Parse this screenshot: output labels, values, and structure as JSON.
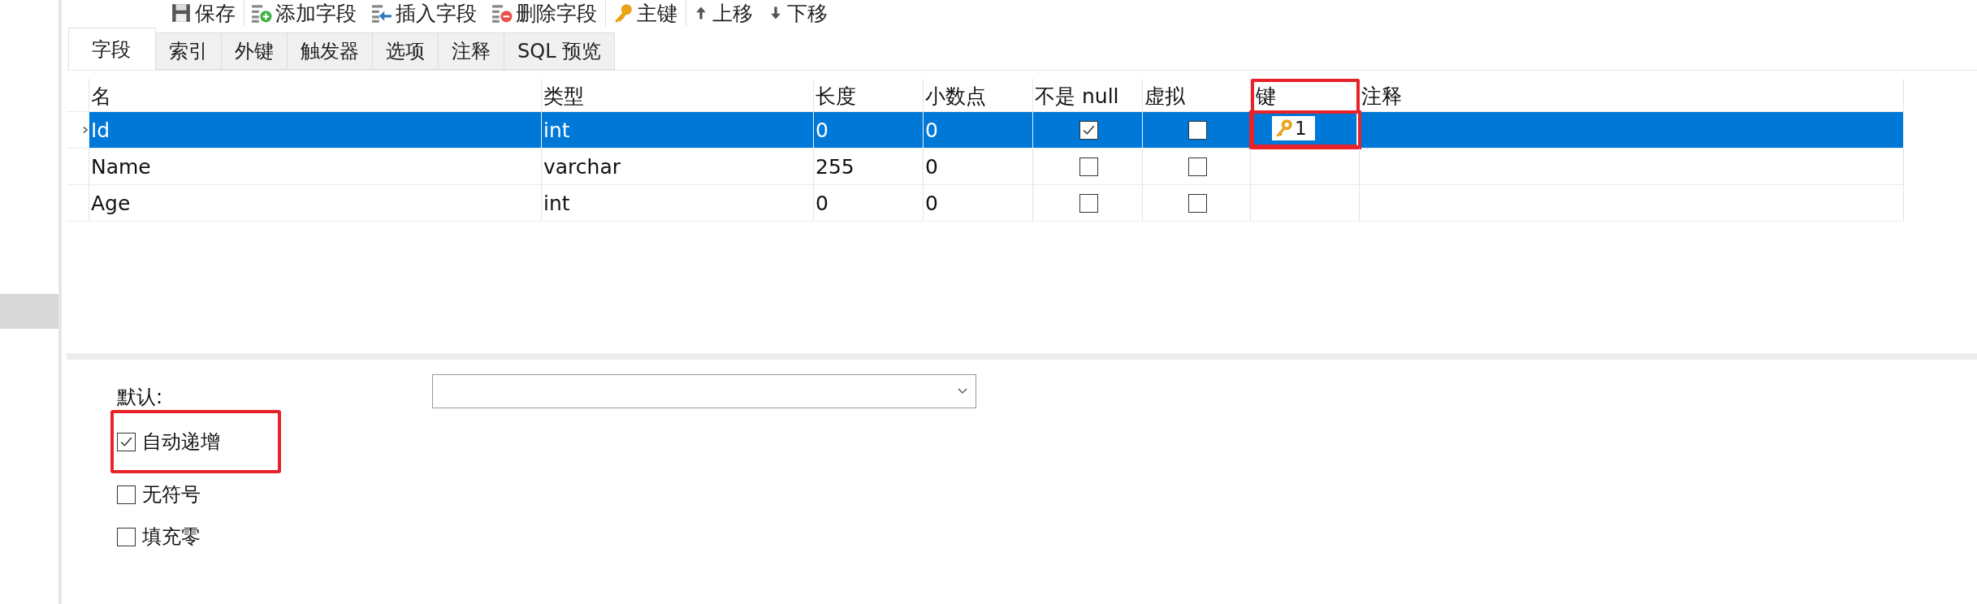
{
  "toolbar": [
    {
      "kind": "save",
      "label": "保存"
    },
    {
      "kind": "add",
      "label": "添加字段"
    },
    {
      "kind": "insert",
      "label": "插入字段"
    },
    {
      "kind": "delete",
      "label": "删除字段"
    },
    {
      "kind": "key",
      "label": "主键"
    },
    {
      "kind": "up",
      "label": "上移"
    },
    {
      "kind": "down",
      "label": "下移"
    }
  ],
  "tabs": [
    {
      "label": "字段",
      "selected": true
    },
    {
      "label": "索引",
      "selected": false
    },
    {
      "label": "外键",
      "selected": false
    },
    {
      "label": "触发器",
      "selected": false
    },
    {
      "label": "选项",
      "selected": false
    },
    {
      "label": "注释",
      "selected": false
    },
    {
      "label": "SQL 预览",
      "selected": false
    }
  ],
  "table": {
    "columns": [
      {
        "label": "名",
        "highlighted": false
      },
      {
        "label": "类型",
        "highlighted": false
      },
      {
        "label": "长度",
        "highlighted": false
      },
      {
        "label": "小数点",
        "highlighted": false
      },
      {
        "label": "不是 null",
        "highlighted": false
      },
      {
        "label": "虚拟",
        "highlighted": false
      },
      {
        "label": "键",
        "highlighted": true
      },
      {
        "label": "注释",
        "highlighted": false
      }
    ],
    "rows": [
      {
        "name": "Id",
        "type": "int",
        "length": "0",
        "decimals": "0",
        "not_null": true,
        "virtual": false,
        "key": "1",
        "selected": true
      },
      {
        "name": "Name",
        "type": "varchar",
        "length": "255",
        "decimals": "0",
        "not_null": false,
        "virtual": false,
        "selected": false
      },
      {
        "name": "Age",
        "type": "int",
        "length": "0",
        "decimals": "0",
        "not_null": false,
        "virtual": false,
        "selected": false
      }
    ]
  },
  "properties": {
    "default_label": "默认:",
    "options": [
      {
        "label": "自动递增",
        "checked": true,
        "highlighted": true
      },
      {
        "label": "无符号",
        "checked": false,
        "highlighted": false
      },
      {
        "label": "填充零",
        "checked": false,
        "highlighted": false
      }
    ]
  }
}
